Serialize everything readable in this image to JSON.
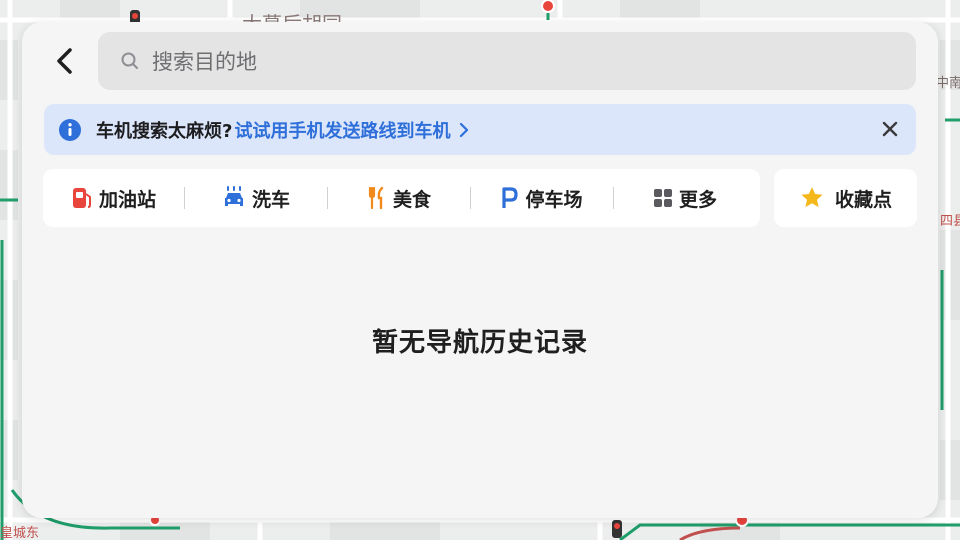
{
  "map": {
    "labels": [
      "大慕后胡同",
      "中南",
      "四县",
      "皇城东"
    ]
  },
  "search": {
    "placeholder": "搜索目的地"
  },
  "banner": {
    "text": "车机搜索太麻烦?",
    "link": "试试用手机发送路线到车机"
  },
  "quick_actions": [
    {
      "label": "加油站",
      "icon": "fuel-pump-icon",
      "color": "#e8453c"
    },
    {
      "label": "洗车",
      "icon": "car-wash-icon",
      "color": "#2e6fd9"
    },
    {
      "label": "美食",
      "icon": "fork-knife-icon",
      "color": "#f08a1c"
    },
    {
      "label": "停车场",
      "icon": "parking-icon",
      "color": "#2e6fd9"
    },
    {
      "label": "更多",
      "icon": "grid-icon",
      "color": "#5b5b5f"
    }
  ],
  "favorites": {
    "label": "收藏点",
    "icon": "star-icon",
    "color": "#f5b81c"
  },
  "empty_state": "暂无导航历史记录",
  "colors": {
    "accent": "#2e6fd9",
    "banner_bg": "#dbe6fb",
    "panel_bg": "#f5f5f5"
  }
}
